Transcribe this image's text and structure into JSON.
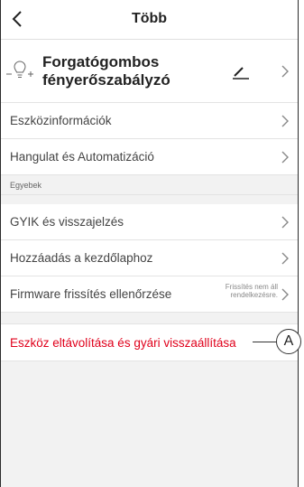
{
  "header": {
    "title": "Több"
  },
  "device": {
    "name_line1": "Forgatógombos",
    "name_line2": "fényerőszabályzó"
  },
  "menu": {
    "device_info": "Eszközinformációk",
    "scenes": "Hangulat és Automatizáció",
    "section_other": "Egyebek",
    "faq": "GYIK és visszajelzés",
    "add_home": "Hozzáadás a kezdőlaphoz",
    "firmware": "Firmware frissítés ellenőrzése",
    "firmware_note_line1": "Frissítés nem áll",
    "firmware_note_line2": "rendelkezésre."
  },
  "remove": {
    "label": "Eszköz eltávolítása és gyári visszaállítása"
  },
  "annotation": {
    "label": "A"
  }
}
